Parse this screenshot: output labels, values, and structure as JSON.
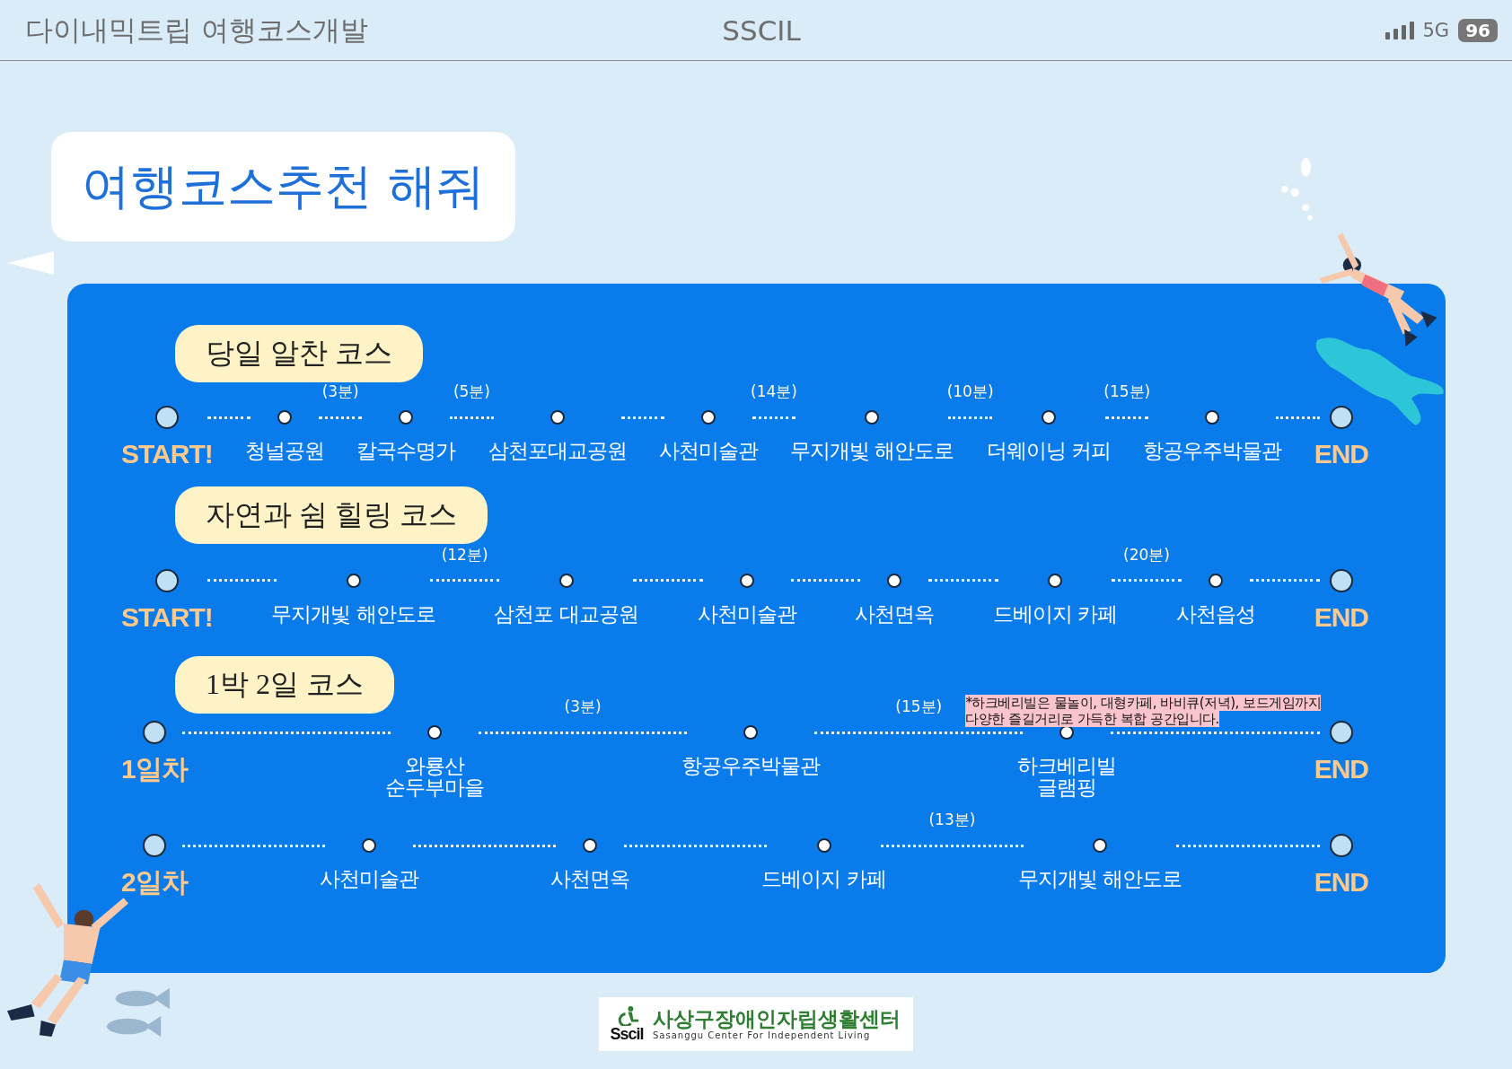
{
  "status_bar": {
    "title": "다이내믹트립 여행코스개발",
    "brand": "SSCIL",
    "network": "5G",
    "battery": "96"
  },
  "heading": "여행코스추천 해줘",
  "courses": [
    {
      "title": "당일 알찬 코스",
      "routes": [
        {
          "stops": [
            {
              "kind": "endpoint",
              "label": "START!"
            },
            {
              "kind": "stop",
              "label": "청널공원"
            },
            {
              "kind": "stop",
              "label": "칼국수명가",
              "time": "(3분)"
            },
            {
              "kind": "stop",
              "label": "삼천포대교공원",
              "time": "(5분)"
            },
            {
              "kind": "stop",
              "label": "사천미술관"
            },
            {
              "kind": "stop",
              "label": "무지개빛 해안도로",
              "time": "(14분)"
            },
            {
              "kind": "stop",
              "label": "더웨이닝 커피",
              "time": "(10분)"
            },
            {
              "kind": "stop",
              "label": "항공우주박물관",
              "time": "(15분)"
            },
            {
              "kind": "endpoint",
              "label": "END"
            }
          ]
        }
      ]
    },
    {
      "title": "자연과 쉼 힐링 코스",
      "routes": [
        {
          "stops": [
            {
              "kind": "endpoint",
              "label": "START!"
            },
            {
              "kind": "stop",
              "label": "무지개빛 해안도로"
            },
            {
              "kind": "stop",
              "label": "삼천포 대교공원",
              "time": "(12분)"
            },
            {
              "kind": "stop",
              "label": "사천미술관"
            },
            {
              "kind": "stop",
              "label": "사천면옥"
            },
            {
              "kind": "stop",
              "label": "드베이지 카페"
            },
            {
              "kind": "stop",
              "label": "사천읍성",
              "time": "(20분)"
            },
            {
              "kind": "endpoint",
              "label": "END"
            }
          ]
        }
      ]
    },
    {
      "title": "1박 2일 코스",
      "routes": [
        {
          "stops": [
            {
              "kind": "endpoint",
              "label": "1일차"
            },
            {
              "kind": "stop",
              "label": "와룡산\n순두부마을"
            },
            {
              "kind": "stop",
              "label": "항공우주박물관",
              "time": "(3분)"
            },
            {
              "kind": "stop",
              "label": "하크베리빌\n글램핑",
              "time": "(15분)",
              "note": "*하크베리빌은 물놀이, 대형카페, 바비큐(저녁), 보드게임까지\n다양한 즐길거리로 가득한 복합 공간입니다."
            },
            {
              "kind": "endpoint",
              "label": "END"
            }
          ]
        },
        {
          "stops": [
            {
              "kind": "endpoint",
              "label": "2일차"
            },
            {
              "kind": "stop",
              "label": "사천미술관"
            },
            {
              "kind": "stop",
              "label": "사천면옥"
            },
            {
              "kind": "stop",
              "label": "드베이지 카페"
            },
            {
              "kind": "stop",
              "label": "무지개빛 해안도로",
              "time": "(13분)"
            },
            {
              "kind": "endpoint",
              "label": "END"
            }
          ]
        }
      ]
    }
  ],
  "logo": {
    "mark": "Sscil",
    "name": "사상구장애인자립생활센터",
    "subtitle": "Sasanggu Center For Independent Living"
  }
}
